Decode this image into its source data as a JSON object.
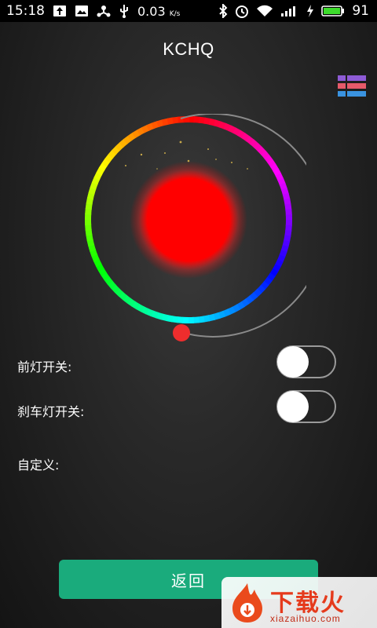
{
  "status_bar": {
    "time": "15:18",
    "network_speed": "0.03",
    "network_unit": "K/s",
    "battery_level": "91",
    "icons": [
      "upload-icon",
      "gallery-icon",
      "usb-icon",
      "usb-debug-icon",
      "bluetooth-icon",
      "alarm-icon",
      "wifi-icon",
      "signal-icon",
      "charging-icon",
      "battery-icon"
    ]
  },
  "header": {
    "title": "KCHQ",
    "menu_icon": "color-list-icon"
  },
  "color_picker": {
    "selected_color": "#ff0000",
    "slider_value": 0.0
  },
  "settings": {
    "headlight_label": "前灯开关:",
    "headlight_on": false,
    "brake_light_label": "刹车灯开关:",
    "brake_light_on": false,
    "custom_label": "自定义:"
  },
  "footer": {
    "back_label": "返回",
    "accent_color": "#1aab7c"
  },
  "watermark": {
    "brand": "下载火",
    "url": "xiazaihuo.com"
  }
}
